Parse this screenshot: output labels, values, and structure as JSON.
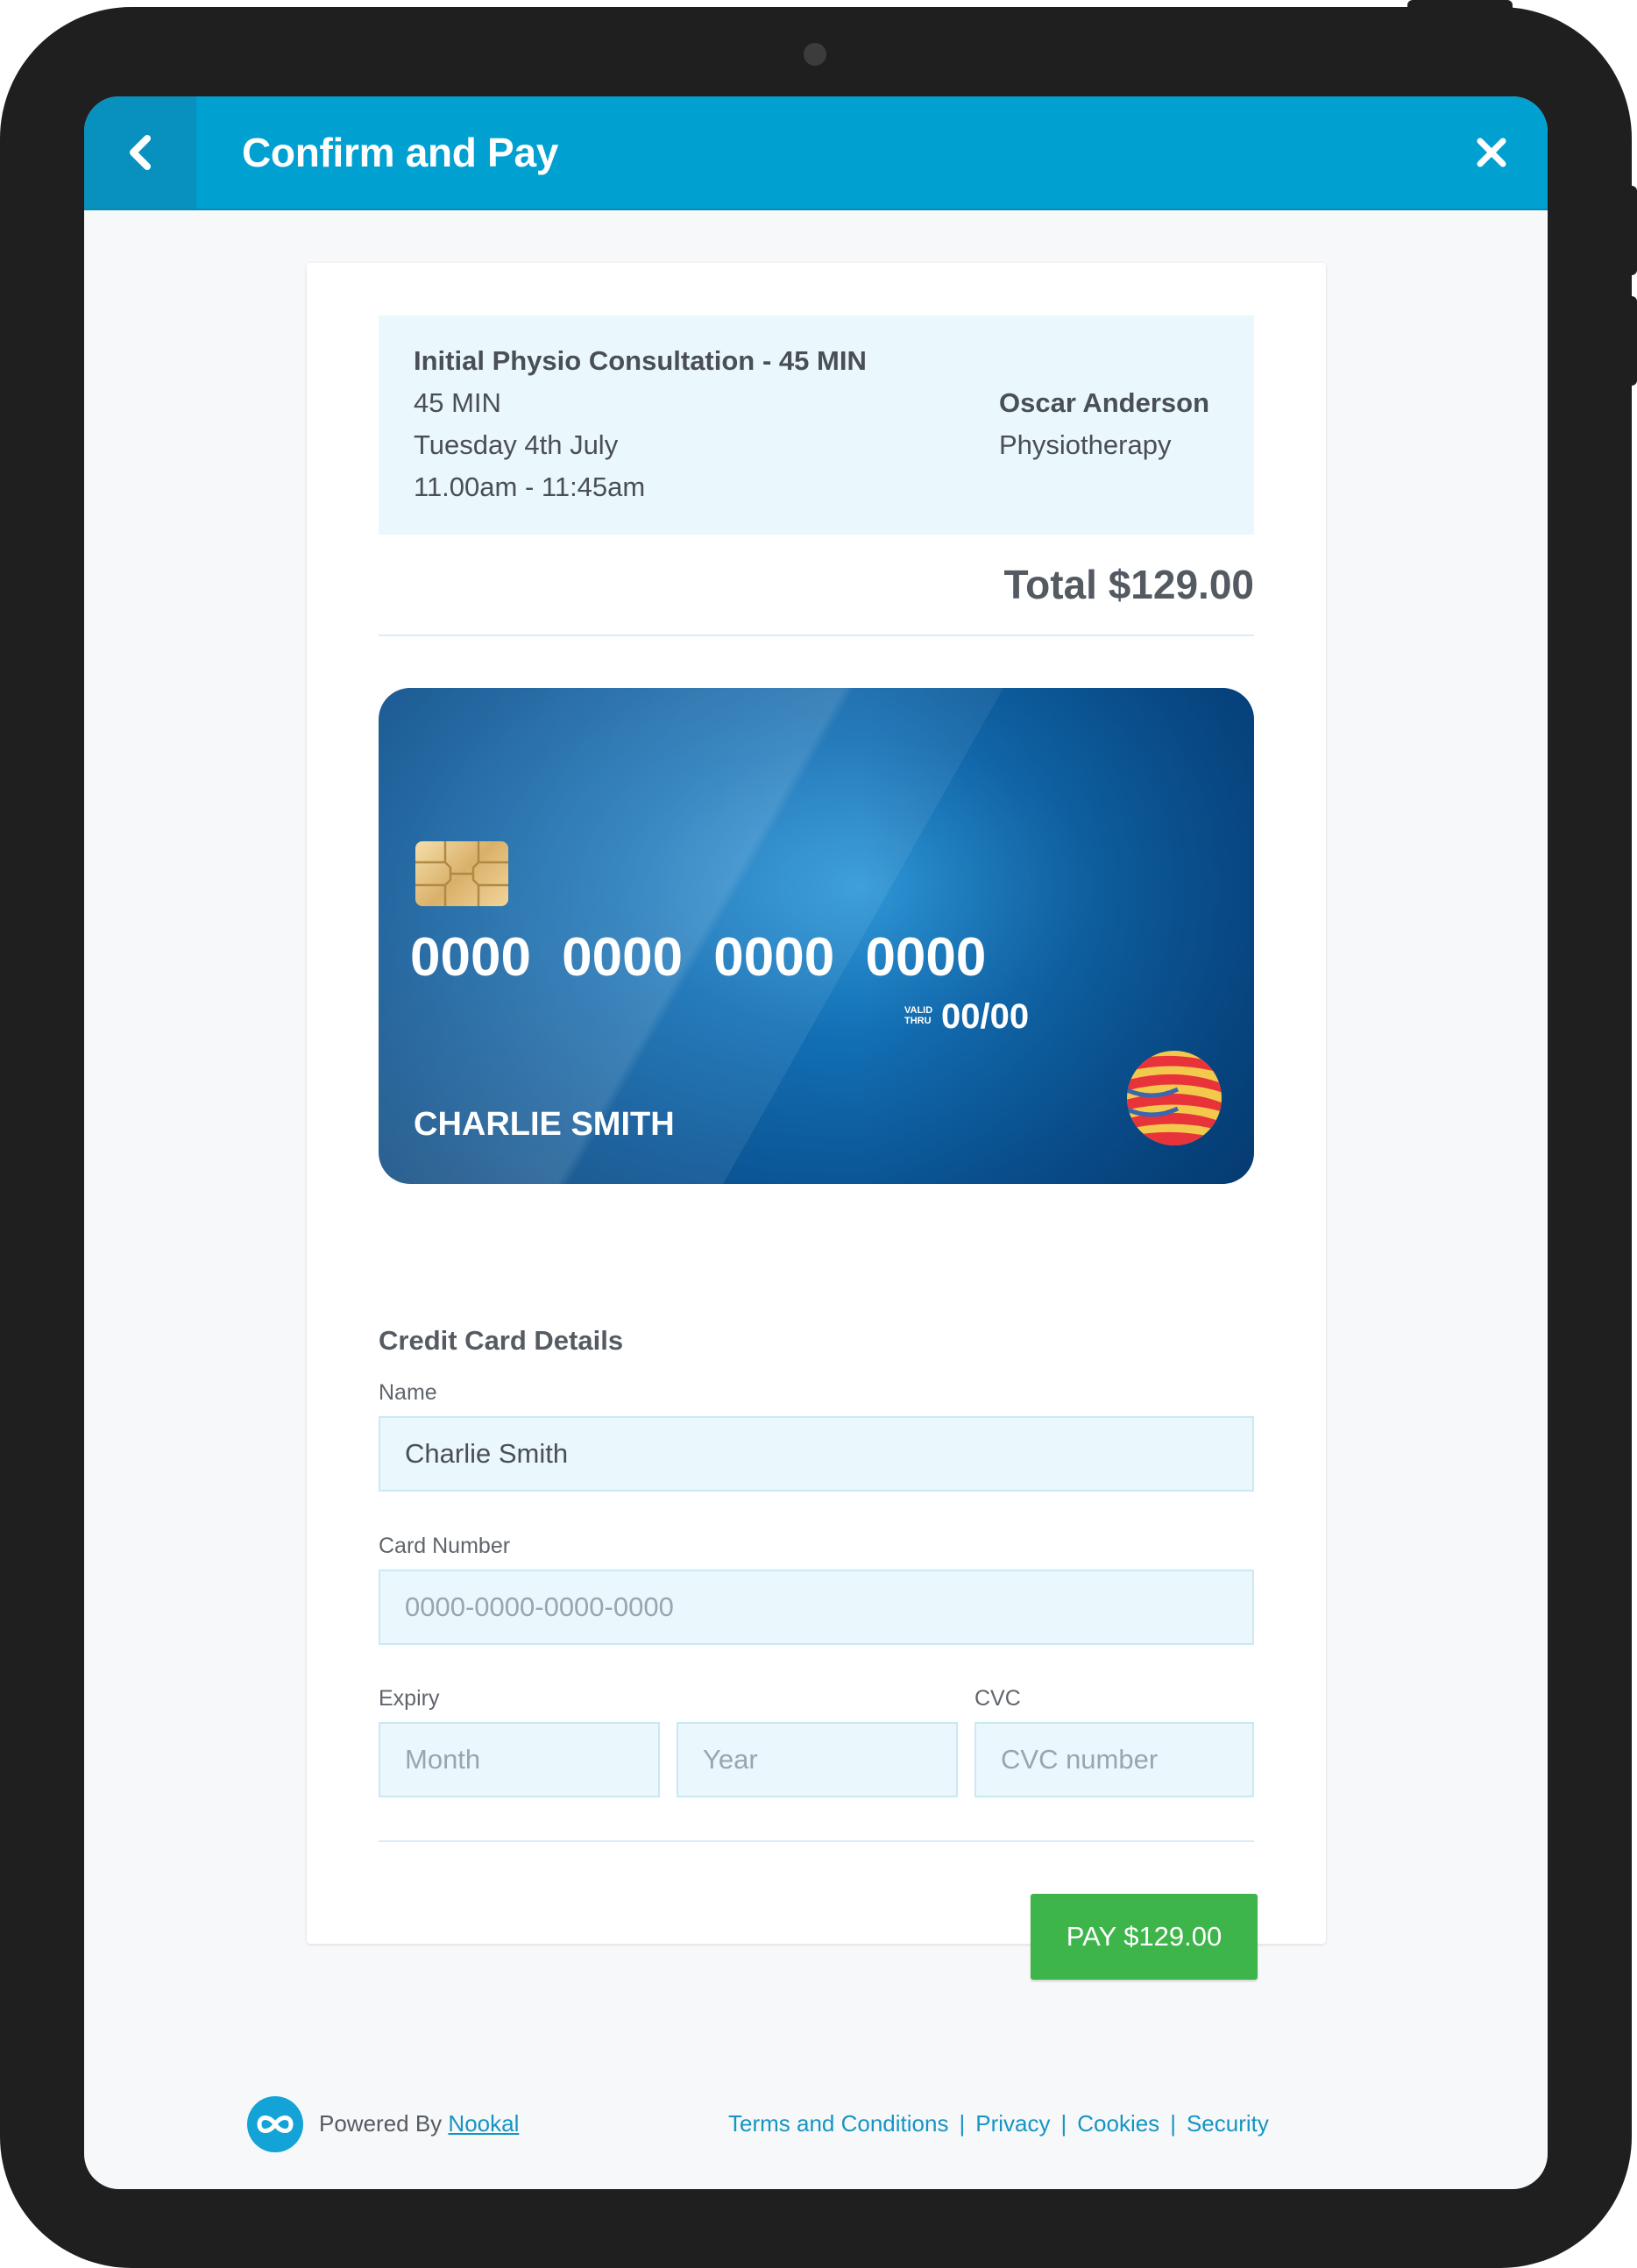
{
  "header": {
    "title": "Confirm and Pay",
    "back_icon": "chevron-left-icon",
    "close_icon": "close-icon"
  },
  "appointment": {
    "service": "Initial Physio Consultation",
    "duration_suffix": "- 45 MIN",
    "duration": "45 MIN",
    "date": "Tuesday 4th July",
    "time": "11.00am - 11:45am",
    "practitioner": "Oscar Anderson",
    "discipline": "Physiotherapy"
  },
  "total": "Total $129.00",
  "card_preview": {
    "number": "0000 0000 0000 0000",
    "valid_label_1": "VALID",
    "valid_label_2": "THRU",
    "expiry": "00/00",
    "holder": "CHARLIE SMITH"
  },
  "form": {
    "section_title": "Credit Card Details",
    "name_label": "Name",
    "name_value": "Charlie Smith",
    "card_number_label": "Card Number",
    "card_number_placeholder": "0000-0000-0000-0000",
    "expiry_label": "Expiry",
    "month_placeholder": "Month",
    "year_placeholder": "Year",
    "cvc_label": "CVC",
    "cvc_placeholder": "CVC number",
    "pay_label": "PAY $129.00"
  },
  "footer": {
    "powered_by": "Powered By",
    "brand_link": "Nookal",
    "links": [
      "Terms and Conditions",
      "Privacy",
      "Cookies",
      "Security"
    ],
    "separator": "|"
  },
  "colors": {
    "header": "#00a0d1",
    "pay_button": "#3db54a",
    "link": "#1595c4"
  }
}
